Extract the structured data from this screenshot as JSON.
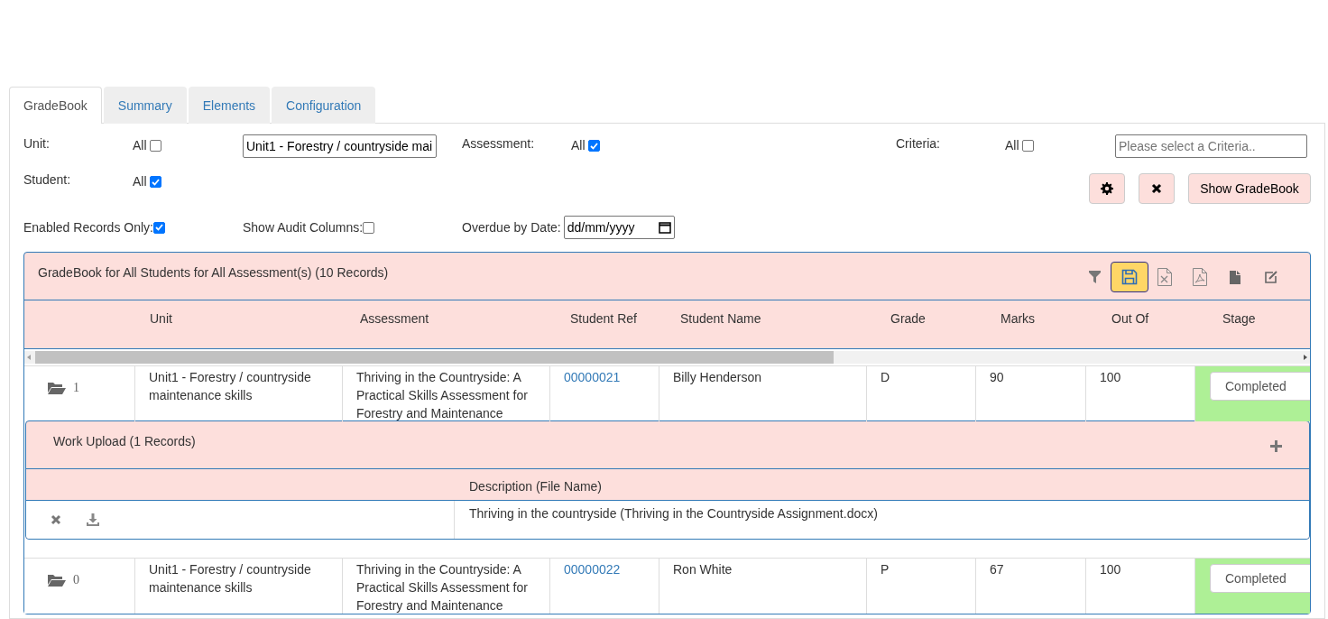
{
  "tabs": [
    {
      "label": "GradeBook",
      "selected": true
    },
    {
      "label": "Summary",
      "selected": false
    },
    {
      "label": "Elements",
      "selected": false
    },
    {
      "label": "Configuration",
      "selected": false
    }
  ],
  "filters": {
    "unit": {
      "label": "Unit:",
      "all_label": "All",
      "all_checked": false,
      "value": "Unit1 - Forestry / countryside mai"
    },
    "assessment": {
      "label": "Assessment:",
      "all_label": "All",
      "all_checked": true
    },
    "criteria": {
      "label": "Criteria:",
      "all_label": "All",
      "all_checked": false,
      "placeholder": "Please select a Criteria.."
    },
    "student": {
      "label": "Student:",
      "all_label": "All",
      "all_checked": true
    }
  },
  "options": {
    "enabled_records_only": {
      "label": "Enabled Records Only:",
      "checked": true
    },
    "show_audit_columns": {
      "label": "Show Audit Columns:",
      "checked": false
    },
    "overdue_by_date": {
      "label": "Overdue by Date:",
      "placeholder": "dd/mm/yyyy"
    }
  },
  "show_button": "Show GradeBook",
  "gradebook": {
    "title": "GradeBook for All Students for All Assessment(s) (10 Records)",
    "toolbar": [
      {
        "kind": "filter",
        "selected": false
      },
      {
        "kind": "save",
        "selected": true
      },
      {
        "kind": "excel",
        "selected": false
      },
      {
        "kind": "pdf",
        "selected": false
      },
      {
        "kind": "file",
        "selected": false
      },
      {
        "kind": "edit",
        "selected": false
      }
    ],
    "columns": [
      "Unit",
      "Assessment",
      "Student Ref",
      "Student Name",
      "Grade",
      "Marks",
      "Out Of",
      "Stage"
    ],
    "rows": [
      {
        "count": "1",
        "unit": "Unit1 - Forestry / countryside maintenance skills",
        "assessment": "Thriving in the Countryside: A Practical Skills Assessment for Forestry and Maintenance",
        "student_ref": "00000021",
        "student_name": "Billy Henderson",
        "grade": "D",
        "marks": "90",
        "out_of": "100",
        "stage": "Completed",
        "work_upload": {
          "title": "Work Upload (1 Records)",
          "columns": [
            "Description (File Name)"
          ],
          "rows": [
            {
              "description": "Thriving in the countryside (Thriving in the Countryside Assignment.docx)"
            }
          ]
        }
      },
      {
        "count": "0",
        "unit": "Unit1 - Forestry / countryside maintenance skills",
        "assessment": "Thriving in the Countryside: A Practical Skills Assessment for Forestry and Maintenance",
        "student_ref": "00000022",
        "student_name": "Ron White",
        "grade": "P",
        "marks": "67",
        "out_of": "100",
        "stage": "Completed"
      }
    ]
  }
}
